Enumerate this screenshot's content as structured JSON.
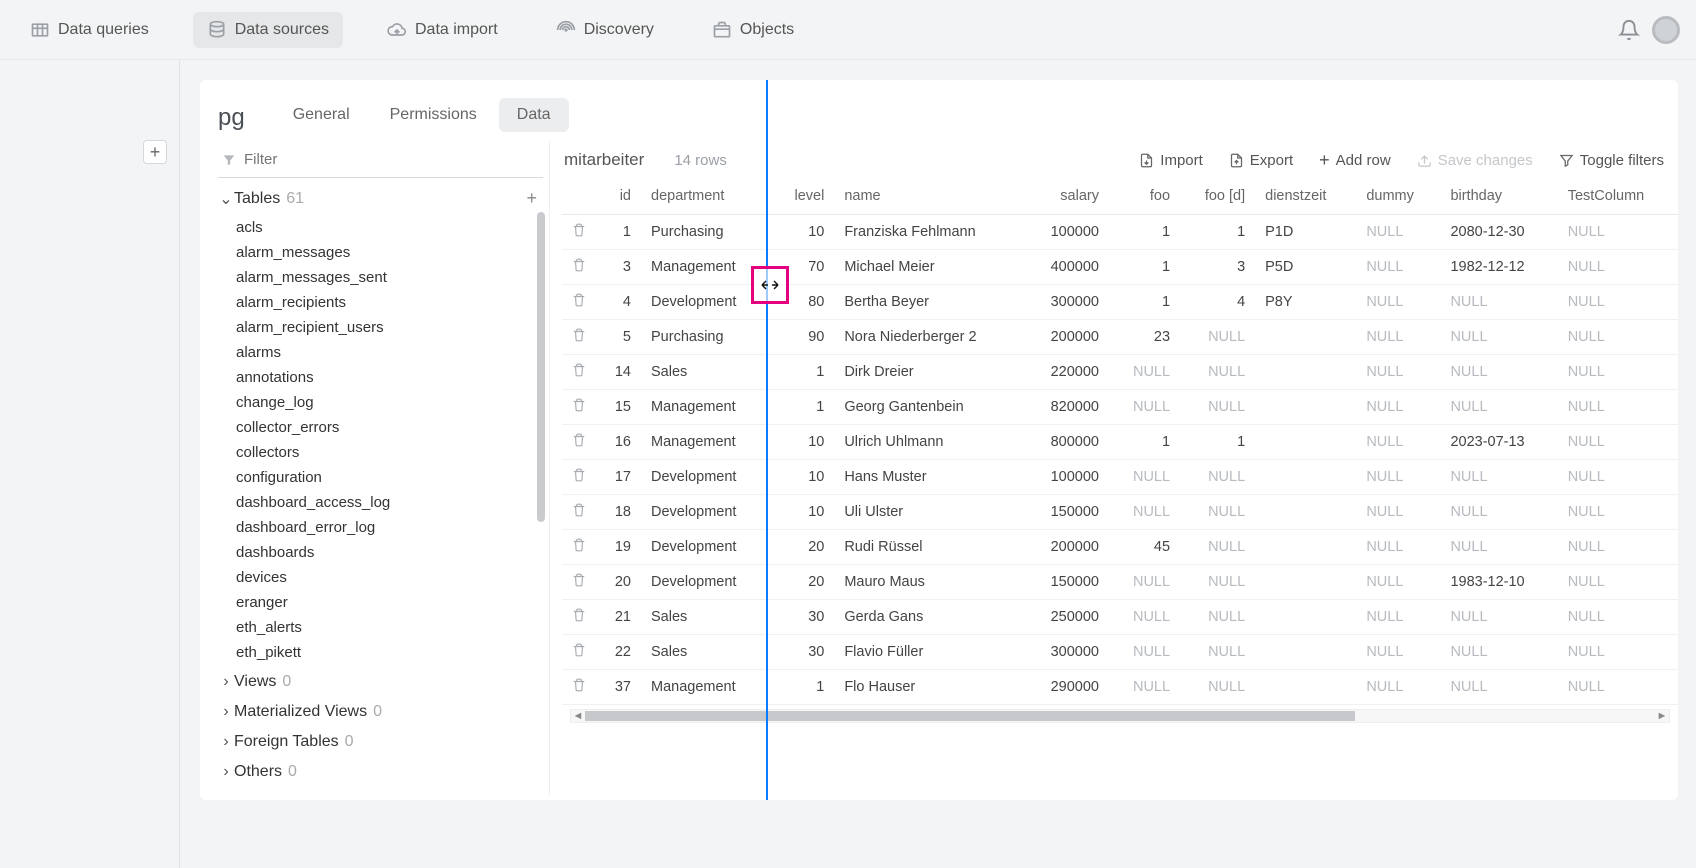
{
  "topnav": [
    {
      "label": "Data queries",
      "icon": "table"
    },
    {
      "label": "Data sources",
      "icon": "db",
      "active": true
    },
    {
      "label": "Data import",
      "icon": "cloud"
    },
    {
      "label": "Discovery",
      "icon": "signal"
    },
    {
      "label": "Objects",
      "icon": "box"
    }
  ],
  "panel_title": "pg",
  "tabs": [
    {
      "label": "General"
    },
    {
      "label": "Permissions"
    },
    {
      "label": "Data",
      "active": true
    }
  ],
  "filter_placeholder": "Filter",
  "tree": {
    "groups": [
      {
        "name": "Tables",
        "count": "61",
        "expanded": true,
        "items": [
          "acls",
          "alarm_messages",
          "alarm_messages_sent",
          "alarm_recipients",
          "alarm_recipient_users",
          "alarms",
          "annotations",
          "change_log",
          "collector_errors",
          "collectors",
          "configuration",
          "dashboard_access_log",
          "dashboard_error_log",
          "dashboards",
          "devices",
          "eranger",
          "eth_alerts",
          "eth_pikett"
        ]
      },
      {
        "name": "Views",
        "count": "0",
        "expanded": false
      },
      {
        "name": "Materialized Views",
        "count": "0",
        "expanded": false
      },
      {
        "name": "Foreign Tables",
        "count": "0",
        "expanded": false
      },
      {
        "name": "Others",
        "count": "0",
        "expanded": false
      }
    ]
  },
  "grid": {
    "title": "mitarbeiter",
    "rowcount_text": "14 rows",
    "actions": {
      "import": "Import",
      "export": "Export",
      "add_row": "Add row",
      "save_changes": "Save changes",
      "toggle_filters": "Toggle filters"
    },
    "columns": [
      "id",
      "department",
      "level",
      "name",
      "salary",
      "foo",
      "foo [d]",
      "dienstzeit",
      "dummy",
      "birthday",
      "TestColumn"
    ],
    "rows": [
      {
        "id": 1,
        "department": "Purchasing",
        "level": 10,
        "name": "Franziska Fehlmann",
        "salary": 100000,
        "foo": "1",
        "foo_d": "1",
        "dienstzeit": "P1D",
        "dummy": "NULL",
        "birthday": "2080-12-30",
        "TestColumn": "NULL"
      },
      {
        "id": 3,
        "department": "Management",
        "level": 70,
        "name": "Michael Meier",
        "salary": 400000,
        "foo": "1",
        "foo_d": "3",
        "dienstzeit": "P5D",
        "dummy": "NULL",
        "birthday": "1982-12-12",
        "TestColumn": "NULL"
      },
      {
        "id": 4,
        "department": "Development",
        "level": 80,
        "name": "Bertha Beyer",
        "salary": 300000,
        "foo": "1",
        "foo_d": "4",
        "dienstzeit": "P8Y",
        "dummy": "NULL",
        "birthday": "NULL",
        "TestColumn": "NULL"
      },
      {
        "id": 5,
        "department": "Purchasing",
        "level": 90,
        "name": "Nora Niederberger 2",
        "salary": 200000,
        "foo": "23",
        "foo_d": "NULL",
        "dienstzeit": "",
        "dummy": "NULL",
        "birthday": "NULL",
        "TestColumn": "NULL"
      },
      {
        "id": 14,
        "department": "Sales",
        "level": 1,
        "name": "Dirk Dreier",
        "salary": 220000,
        "foo": "NULL",
        "foo_d": "NULL",
        "dienstzeit": "",
        "dummy": "NULL",
        "birthday": "NULL",
        "TestColumn": "NULL"
      },
      {
        "id": 15,
        "department": "Management",
        "level": 1,
        "name": "Georg Gantenbein",
        "salary": 820000,
        "foo": "NULL",
        "foo_d": "NULL",
        "dienstzeit": "",
        "dummy": "NULL",
        "birthday": "NULL",
        "TestColumn": "NULL"
      },
      {
        "id": 16,
        "department": "Management",
        "level": 10,
        "name": "Ulrich Uhlmann",
        "salary": 800000,
        "foo": "1",
        "foo_d": "1",
        "dienstzeit": "",
        "dummy": "NULL",
        "birthday": "2023-07-13",
        "TestColumn": "NULL"
      },
      {
        "id": 17,
        "department": "Development",
        "level": 10,
        "name": "Hans Muster",
        "salary": 100000,
        "foo": "NULL",
        "foo_d": "NULL",
        "dienstzeit": "",
        "dummy": "NULL",
        "birthday": "NULL",
        "TestColumn": "NULL"
      },
      {
        "id": 18,
        "department": "Development",
        "level": 10,
        "name": "Uli Ulster",
        "salary": 150000,
        "foo": "NULL",
        "foo_d": "NULL",
        "dienstzeit": "",
        "dummy": "NULL",
        "birthday": "NULL",
        "TestColumn": "NULL"
      },
      {
        "id": 19,
        "department": "Development",
        "level": 20,
        "name": "Rudi Rüssel",
        "salary": 200000,
        "foo": "45",
        "foo_d": "NULL",
        "dienstzeit": "",
        "dummy": "NULL",
        "birthday": "NULL",
        "TestColumn": "NULL"
      },
      {
        "id": 20,
        "department": "Development",
        "level": 20,
        "name": "Mauro Maus",
        "salary": 150000,
        "foo": "NULL",
        "foo_d": "NULL",
        "dienstzeit": "",
        "dummy": "NULL",
        "birthday": "1983-12-10",
        "TestColumn": "NULL"
      },
      {
        "id": 21,
        "department": "Sales",
        "level": 30,
        "name": "Gerda Gans",
        "salary": 250000,
        "foo": "NULL",
        "foo_d": "NULL",
        "dienstzeit": "",
        "dummy": "NULL",
        "birthday": "NULL",
        "TestColumn": "NULL"
      },
      {
        "id": 22,
        "department": "Sales",
        "level": 30,
        "name": "Flavio Füller",
        "salary": 300000,
        "foo": "NULL",
        "foo_d": "NULL",
        "dienstzeit": "",
        "dummy": "NULL",
        "birthday": "NULL",
        "TestColumn": "NULL"
      },
      {
        "id": 37,
        "department": "Management",
        "level": 1,
        "name": "Flo Hauser",
        "salary": 290000,
        "foo": "NULL",
        "foo_d": "NULL",
        "dienstzeit": "",
        "dummy": "NULL",
        "birthday": "NULL",
        "TestColumn": "NULL"
      }
    ]
  }
}
